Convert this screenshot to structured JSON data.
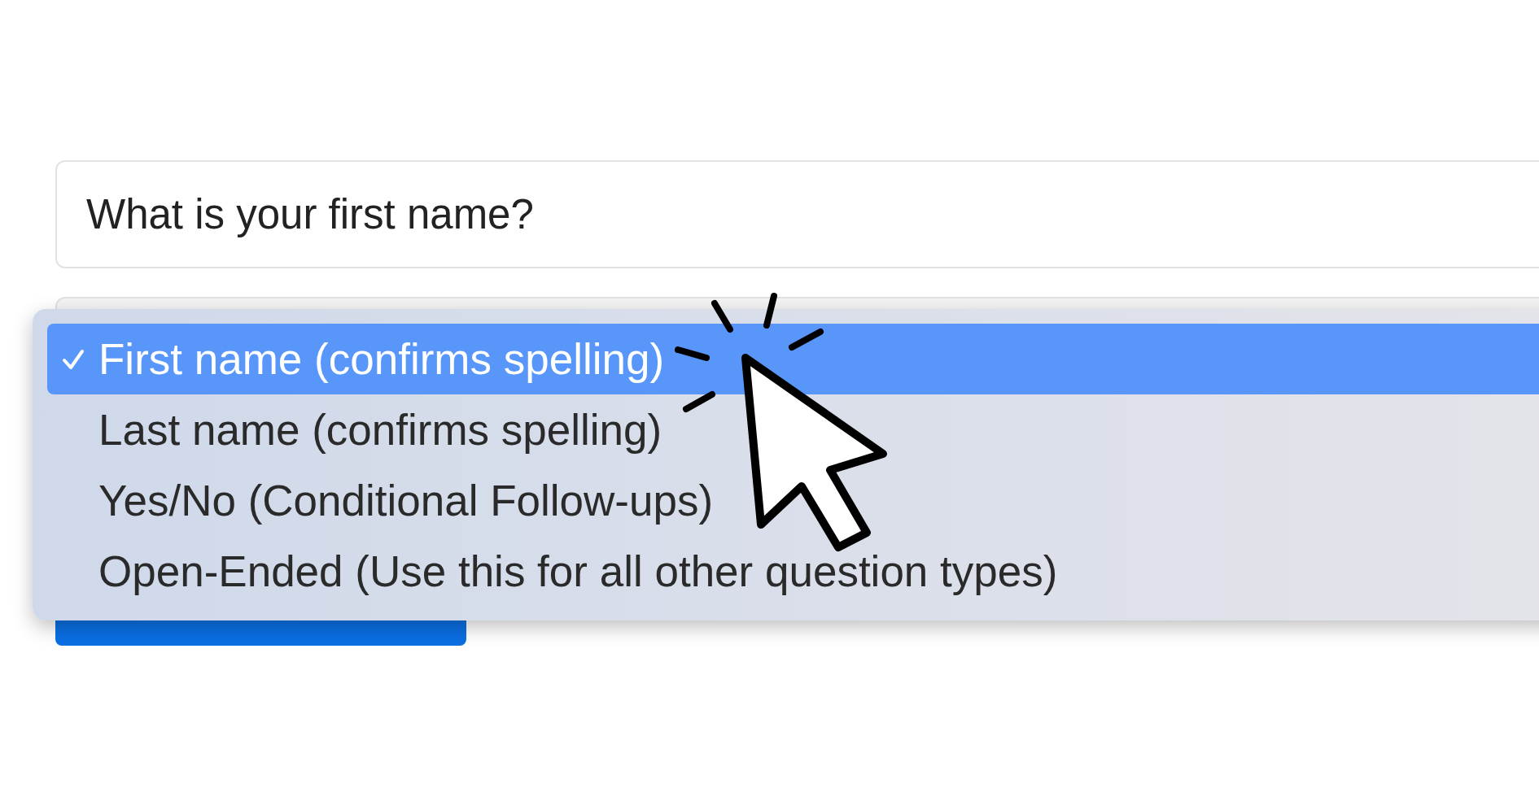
{
  "question_field": {
    "value": "What is your first name?"
  },
  "question_type_menu": {
    "options": [
      {
        "label": "First name (confirms spelling)",
        "selected": true
      },
      {
        "label": "Last name (confirms spelling)",
        "selected": false
      },
      {
        "label": "Yes/No (Conditional Follow-ups)",
        "selected": false
      },
      {
        "label": "Open-Ended (Use this for all other question types)",
        "selected": false
      }
    ]
  }
}
